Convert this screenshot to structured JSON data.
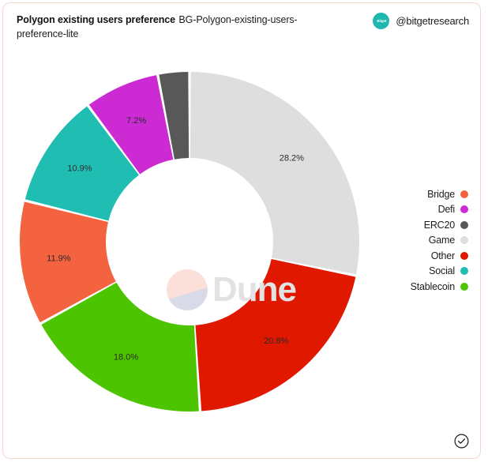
{
  "header": {
    "title_main": "Polygon existing users preference",
    "title_sub": "BG-Polygon-existing-users-preference-lite",
    "avatar_text": "Bitget",
    "avatar_icon": "bitget-avatar-icon",
    "handle": "@bitgetresearch"
  },
  "watermark": {
    "text": "Dune",
    "circle_icon": "dune-logo-icon"
  },
  "footer": {
    "verified_icon": "verified-check-icon"
  },
  "legend": {
    "items": [
      {
        "label": "Bridge",
        "color": "#f4633f"
      },
      {
        "label": "Defi",
        "color": "#cc2bd4"
      },
      {
        "label": "ERC20",
        "color": "#585858"
      },
      {
        "label": "Game",
        "color": "#dedede"
      },
      {
        "label": "Other",
        "color": "#e01800"
      },
      {
        "label": "Social",
        "color": "#1fbdb2"
      },
      {
        "label": "Stablecoin",
        "color": "#4cc400"
      }
    ]
  },
  "chart_data": {
    "type": "pie",
    "variant": "donut",
    "title": "Polygon existing users preference",
    "subtitle": "BG-Polygon-existing-users-preference-lite",
    "value_unit": "%",
    "start_angle_deg": 0,
    "direction": "clockwise",
    "center": [
      246,
      302
    ],
    "outer_radius": 215,
    "inner_radius": 106,
    "legend_position": "right",
    "categories": [
      "Game",
      "Other",
      "Stablecoin",
      "Bridge",
      "Social",
      "Defi",
      "ERC20"
    ],
    "values": [
      28.2,
      20.8,
      18.0,
      11.9,
      10.9,
      7.2,
      3.0
    ],
    "colors": [
      "#dedede",
      "#e01800",
      "#4cc400",
      "#f4633f",
      "#1fbdb2",
      "#cc2bd4",
      "#585858"
    ],
    "slices": [
      {
        "name": "Game",
        "value": 28.2,
        "label": "28.2%",
        "color": "#dedede",
        "label_shown": true
      },
      {
        "name": "Other",
        "value": 20.8,
        "label": "20.8%",
        "color": "#e01800",
        "label_shown": true
      },
      {
        "name": "Stablecoin",
        "value": 18.0,
        "label": "18.0%",
        "color": "#4cc400",
        "label_shown": true
      },
      {
        "name": "Bridge",
        "value": 11.9,
        "label": "11.9%",
        "color": "#f4633f",
        "label_shown": true
      },
      {
        "name": "Social",
        "value": 10.9,
        "label": "10.9%",
        "color": "#1fbdb2",
        "label_shown": true
      },
      {
        "name": "Defi",
        "value": 7.2,
        "label": "7.2%",
        "color": "#cc2bd4",
        "label_shown": true
      },
      {
        "name": "ERC20",
        "value": 3.0,
        "label": "",
        "color": "#585858",
        "label_shown": false
      }
    ],
    "legend_entries": [
      "Bridge",
      "Defi",
      "ERC20",
      "Game",
      "Other",
      "Social",
      "Stablecoin"
    ]
  }
}
